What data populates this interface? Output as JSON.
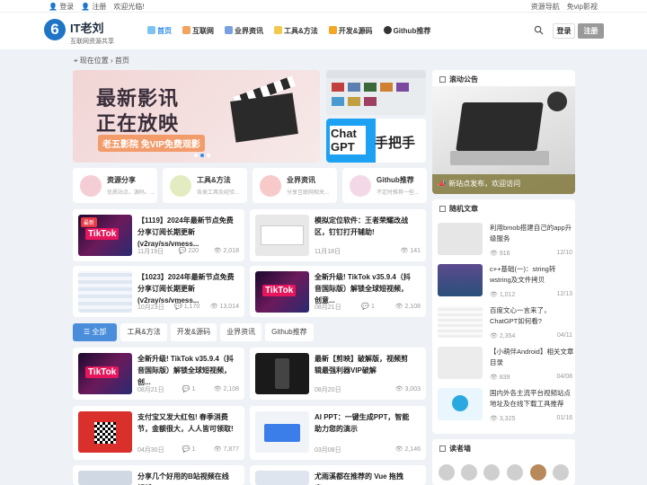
{
  "topbar": {
    "login": "登录",
    "register": "注册",
    "welcome": "欢迎光临!",
    "nav_link": "资源导航",
    "vip_link": "免vip影视"
  },
  "header": {
    "logo_text": "6",
    "brand_title": "IT老刘",
    "brand_subtitle": "互联网资源共享",
    "login_btn": "登录",
    "register_btn": "注册"
  },
  "nav": {
    "items": [
      {
        "label": "首页"
      },
      {
        "label": "互联网"
      },
      {
        "label": "业界资讯"
      },
      {
        "label": "工具&方法"
      },
      {
        "label": "开发&源码"
      },
      {
        "label": "Github推荐"
      }
    ]
  },
  "breadcrumb": {
    "prefix": "现在位置",
    "current": "首页"
  },
  "banner": {
    "line1": "最新影讯",
    "line2": "正在放映",
    "tag": "老五影院  免VIP免费观影"
  },
  "side_banner": {
    "chat_text": "Chat GPT",
    "hand_text": "手把手"
  },
  "categories": [
    {
      "title": "资源分享",
      "sub": "优质站点、源码、...",
      "color": "#f5cdd5"
    },
    {
      "title": "工具&方法",
      "sub": "各类工具及经验...",
      "color": "#e3ecc0"
    },
    {
      "title": "业界资讯",
      "sub": "分享互联网相关...",
      "color": "#f8c9c9"
    },
    {
      "title": "Github推荐",
      "sub": "不定时推荐一些...",
      "color": "#f3d8e8"
    }
  ],
  "featured_posts": [
    {
      "title": "【1119】2024年最新节点免费分享订阅长期更新(v2ray/ss/vmess...",
      "date": "11月19日",
      "comments": "220",
      "views": "2,018",
      "badge": "最新",
      "tk": "TikTok"
    },
    {
      "title": "模拟定位软件：王者荣耀改战区，钉钉打开辅助!",
      "date": "11月18日",
      "comments": "",
      "views": "141"
    },
    {
      "title": "【1023】2024年最新节点免费分享订阅长期更新(v2ray/ss/vmess...",
      "date": "10月23日",
      "comments": "1,170",
      "views": "13,014"
    },
    {
      "title": "全新升级! TikTok v35.9.4（抖音国际版）解锁全球短视频，创意...",
      "date": "08月21日",
      "comments": "1",
      "views": "2,108",
      "tk": "TikTok"
    }
  ],
  "tabs": [
    "全部",
    "工具&方法",
    "开发&源码",
    "业界资讯",
    "Github推荐"
  ],
  "list_posts": [
    {
      "title": "全新升级! TikTok v35.9.4（抖音国际版）解锁全球短视频，创...",
      "date": "08月21日",
      "comments": "1",
      "views": "2,108",
      "tk": "TikTok"
    },
    {
      "title": "最新【剪映】破解版，视频剪辑最强利器VIP破解",
      "date": "08月20日",
      "comments": "",
      "views": "3,003"
    },
    {
      "title": "支付宝又发大红包! 春季消费节，金额很大，人人皆可领取!",
      "date": "04月30日",
      "comments": "1",
      "views": "7,877"
    },
    {
      "title": "AI PPT：一键生成PPT，智能助力您的演示",
      "date": "03月08日",
      "comments": "",
      "views": "2,146"
    },
    {
      "title": "分享几个好用的B站视频在线解析",
      "date": "",
      "comments": "",
      "views": ""
    },
    {
      "title": "尤雨溪都在推荐的 Vue 拖拽库!",
      "date": "",
      "comments": "",
      "views": ""
    }
  ],
  "announcement": {
    "title": "滚动公告",
    "caption": "新站点发布，欢迎访问"
  },
  "random": {
    "title": "随机文章",
    "items": [
      {
        "title": "利用bmob搭建自己的app升级服务",
        "views": "916",
        "date": "12/10"
      },
      {
        "title": "c++基础(一)：string转wstring及文件拷贝",
        "views": "1,012",
        "date": "12/13"
      },
      {
        "title": "百度文心一言来了，ChatGPT如何看?",
        "views": "2,354",
        "date": "04/11"
      },
      {
        "title": "【小萌伴Android】相关文章目录",
        "views": "839",
        "date": "04/08"
      },
      {
        "title": "国内外各主流平台视频站点地址及在线下载工具推荐",
        "views": "3,325",
        "date": "01/16"
      }
    ]
  },
  "readers": {
    "title": "读者墙"
  }
}
